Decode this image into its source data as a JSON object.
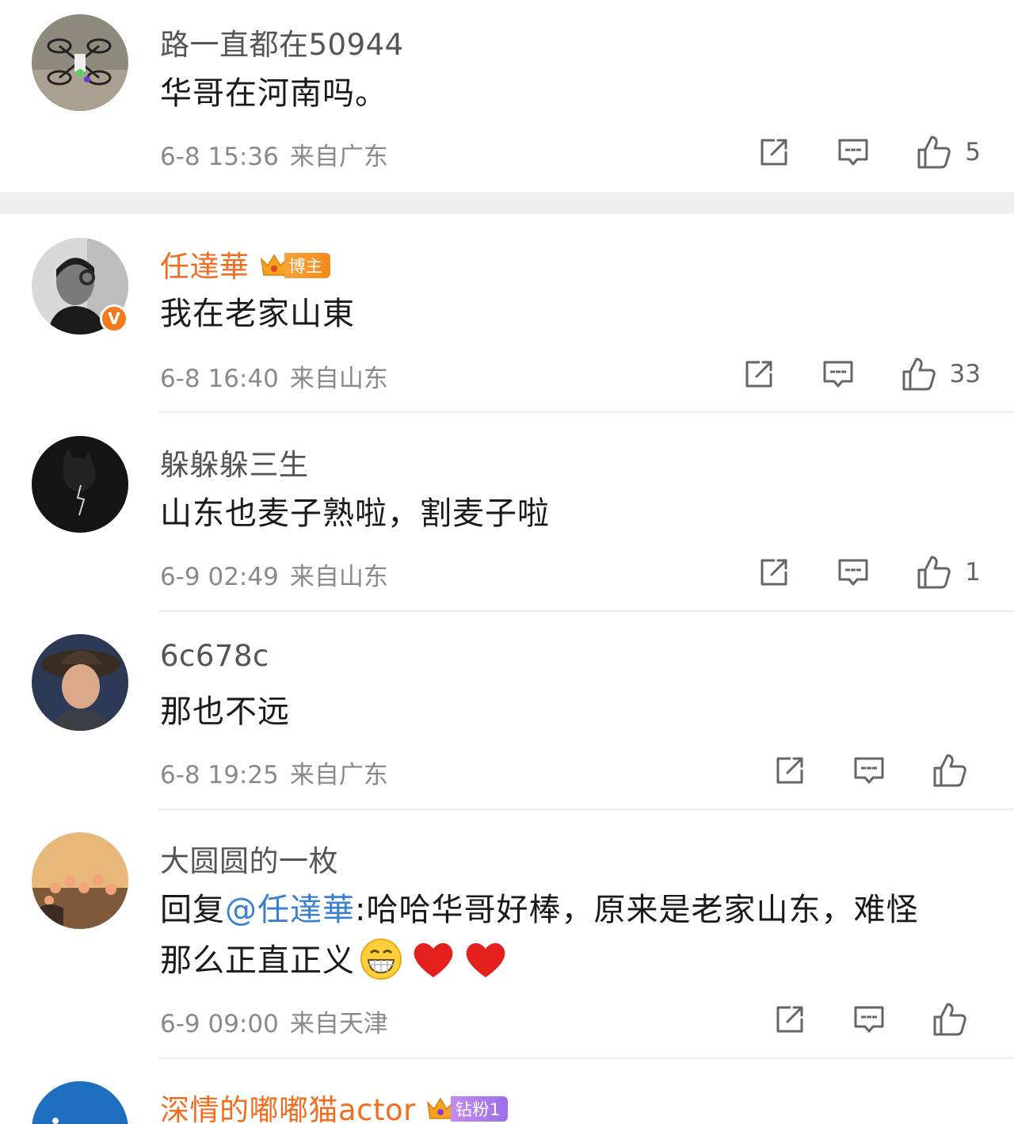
{
  "comments": [
    {
      "username": "路一直都在50944",
      "text": "华哥在河南吗。",
      "date": "6-8 15:36",
      "location": "来自广东",
      "likes": "5",
      "avatar": "drone-photo"
    },
    {
      "username": "任達華",
      "badge": "博主",
      "verified": true,
      "text": "我在老家山東",
      "date": "6-8 16:40",
      "location": "来自山东",
      "likes": "33",
      "avatar": "man-bw-photo"
    },
    {
      "username": "躲躲躲三生",
      "text": "山东也麦子熟啦，割麦子啦",
      "date": "6-9 02:49",
      "location": "来自山东",
      "likes": "1",
      "avatar": "dark-cat-lightning"
    },
    {
      "username": "6c678c",
      "text": "那也不远",
      "date": "6-8 19:25",
      "location": "来自广东",
      "likes": "",
      "avatar": "boy-in-hat"
    },
    {
      "username": "大圆圆的一枚",
      "reply_prefix": "回复",
      "mention": "@任達華",
      "text_line1": ":哈哈华哥好棒，原来是老家山东，难怪",
      "text_line2": "那么正直正义",
      "emojis": [
        "grin-emoji",
        "heart-emoji",
        "heart-emoji"
      ],
      "date": "6-9 09:00",
      "location": "来自天津",
      "likes": "",
      "avatar": "flowers-sunset"
    },
    {
      "username": "深情的嘟嘟猫actor",
      "badge": "钻粉1",
      "avatar": "blue-avatar"
    }
  ],
  "colors": {
    "username_highlight": "#f26d1f",
    "mention": "#3a7fd0",
    "meta": "#8a8a8a",
    "verified": "#f47a20"
  },
  "icons": {
    "share": "share-icon",
    "reply": "reply-icon",
    "like": "like-icon"
  }
}
